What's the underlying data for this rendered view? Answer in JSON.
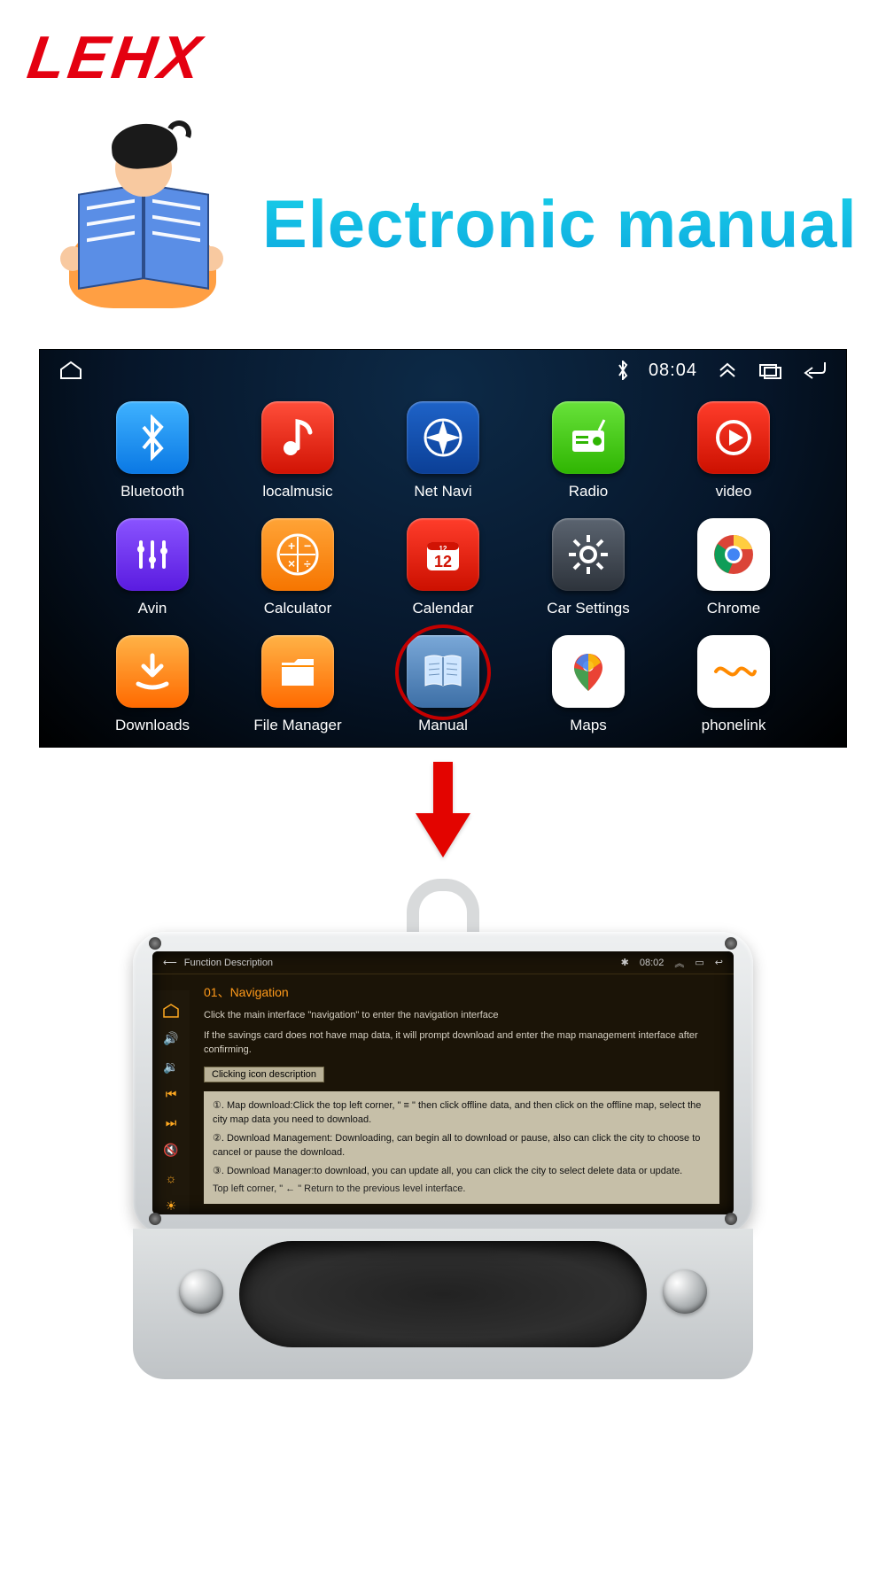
{
  "brand": "LEHX",
  "title": "Electronic manual",
  "statusbar": {
    "time": "08:04"
  },
  "apps": [
    {
      "id": "bluetooth",
      "label": "Bluetooth",
      "bg": "bg-blue",
      "highlight": false
    },
    {
      "id": "localmusic",
      "label": "localmusic",
      "bg": "bg-red",
      "highlight": false
    },
    {
      "id": "netnavi",
      "label": "Net Navi",
      "bg": "bg-navy",
      "highlight": false
    },
    {
      "id": "radio",
      "label": "Radio",
      "bg": "bg-green",
      "highlight": false
    },
    {
      "id": "video",
      "label": "video",
      "bg": "bg-red2",
      "highlight": false
    },
    {
      "id": "avin",
      "label": "Avin",
      "bg": "bg-violet",
      "highlight": false
    },
    {
      "id": "calculator",
      "label": "Calculator",
      "bg": "bg-orange",
      "highlight": false
    },
    {
      "id": "calendar",
      "label": "Calendar",
      "bg": "bg-red2",
      "highlight": false
    },
    {
      "id": "carsettings",
      "label": "Car Settings",
      "bg": "bg-gear",
      "highlight": false
    },
    {
      "id": "chrome",
      "label": "Chrome",
      "bg": "bg-white",
      "highlight": false
    },
    {
      "id": "downloads",
      "label": "Downloads",
      "bg": "bg-orange2",
      "highlight": false
    },
    {
      "id": "filemanager",
      "label": "File Manager",
      "bg": "bg-orange2",
      "highlight": false
    },
    {
      "id": "manual",
      "label": "Manual",
      "bg": "bg-steel",
      "highlight": true
    },
    {
      "id": "maps",
      "label": "Maps",
      "bg": "bg-white",
      "highlight": false
    },
    {
      "id": "phonelink",
      "label": "phonelink",
      "bg": "bg-white",
      "highlight": false
    }
  ],
  "manual_screen": {
    "topbar_title": "Function Description",
    "time": "08:02",
    "section_title": "01、Navigation",
    "line1": "Click the main interface \"navigation\" to enter the navigation interface",
    "line2": "If the savings card does not have map data, it will prompt download and enter the map management interface after confirming.",
    "subhead": "Clicking icon description",
    "items": {
      "i1": "①. Map download:Click the top left corner, \" ≡ \" then click offline data, and then click on the offline map, select the city map data you need to download.",
      "i2": "②. Download Management: Downloading, can begin all to download or pause, also can click the city to choose to cancel or pause the download.",
      "i3": "③. Download Manager:to download, you can update all, you can click the city to select delete data or update.",
      "tail": "Top left corner, \" ← \" Return to the previous level interface."
    }
  }
}
